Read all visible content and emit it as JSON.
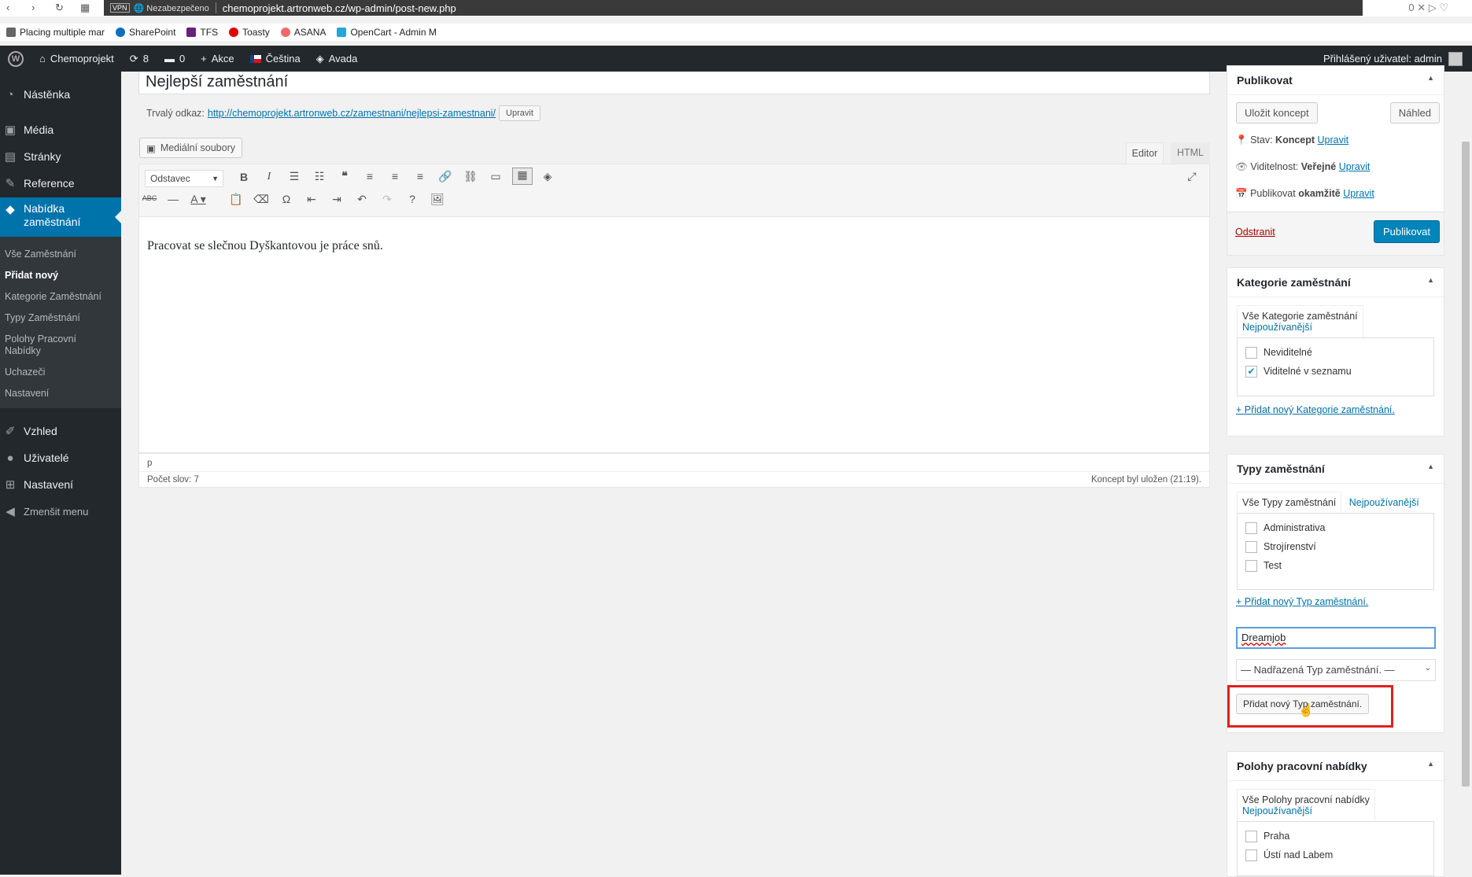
{
  "browser": {
    "vpn": "VPN",
    "security": "Nezabezpečeno",
    "url": "chemoprojekt.artronweb.cz/wp-admin/post-new.php",
    "right_count": "0",
    "bookmarks": [
      {
        "label": "Placing multiple mar",
        "color": "#666"
      },
      {
        "label": "SharePoint",
        "color": "#0a6fc2"
      },
      {
        "label": "TFS",
        "color": "#68217a"
      },
      {
        "label": "Toasty",
        "color": "#d00"
      },
      {
        "label": "ASANA",
        "color": "#f06a6a"
      },
      {
        "label": "OpenCart - Admin M",
        "color": "#23a7d6"
      }
    ]
  },
  "adminbar": {
    "site": "Chemoprojekt",
    "updates": "8",
    "comments": "0",
    "new": "Akce",
    "lang": "Čeština",
    "theme": "Avada",
    "user": "Přihlášený uživatel: admin"
  },
  "sidebar": {
    "items": [
      "Nástěnka",
      "Média",
      "Stránky",
      "Reference",
      "Nabídka zaměstnání",
      "Vzhled",
      "Uživatelé",
      "Nastavení",
      "Zmenšit menu"
    ],
    "submenu": [
      "Vše Zaměstnání",
      "Přidat nový",
      "Kategorie Zaměstnání",
      "Typy Zaměstnání",
      "Polohy Pracovní Nabídky",
      "Uchazeči",
      "Nastavení"
    ]
  },
  "post": {
    "title": "Nejlepší zaměstnání",
    "permalink_label": "Trvalý odkaz:",
    "permalink_url": "http://chemoprojekt.artronweb.cz/zamestnani/nejlepsi-zamestnani/",
    "permalink_edit": "Upravit",
    "media_button": "Mediální soubory",
    "tab_editor": "Editor",
    "tab_html": "HTML",
    "format": "Odstavec",
    "content": "Pracovat se slečnou Dyškantovou je práce snů.",
    "path": "p",
    "wordcount": "Počet slov: 7",
    "saved": "Koncept byl uložen (21:19)."
  },
  "publish": {
    "title": "Publikovat",
    "save_draft": "Uložit koncept",
    "preview": "Náhled",
    "status_label": "Stav:",
    "status_value": "Koncept",
    "visibility_label": "Viditelnost:",
    "visibility_value": "Veřejné",
    "schedule_label": "Publikovat",
    "schedule_value": "okamžitě",
    "edit": "Upravit",
    "delete": "Odstranit",
    "publish": "Publikovat"
  },
  "categories": {
    "title": "Kategorie zaměstnání",
    "tab_all": "Vše Kategorie zaměstnání",
    "tab_popular": "Nejpoužívanější",
    "items": [
      {
        "label": "Neviditelné",
        "checked": false
      },
      {
        "label": "Viditelné v seznamu",
        "checked": true
      }
    ],
    "add_link": "+ Přidat nový Kategorie zaměstnání."
  },
  "types": {
    "title": "Typy zaměstnání",
    "tab_all": "Vše Typy zaměstnání",
    "tab_popular": "Nejpoužívanější",
    "items": [
      {
        "label": "Administrativa",
        "checked": false
      },
      {
        "label": "Strojírenství",
        "checked": false
      },
      {
        "label": "Test",
        "checked": false
      }
    ],
    "add_link": "+ Přidat nový Typ zaměstnání.",
    "new_value": "Dreamjob",
    "parent_select": "— Nadřazená Typ zaměstnání. —",
    "add_button": "Přidat nový Typ zaměstnání.",
    "highlight_color": "#e02020"
  },
  "locations": {
    "title": "Polohy pracovní nabídky",
    "tab_all": "Vše Polohy pracovní nabídky",
    "tab_popular": "Nejpoužívanější",
    "items": [
      {
        "label": "Praha",
        "checked": false
      },
      {
        "label": "Ústí nad Labem",
        "checked": false
      }
    ]
  }
}
